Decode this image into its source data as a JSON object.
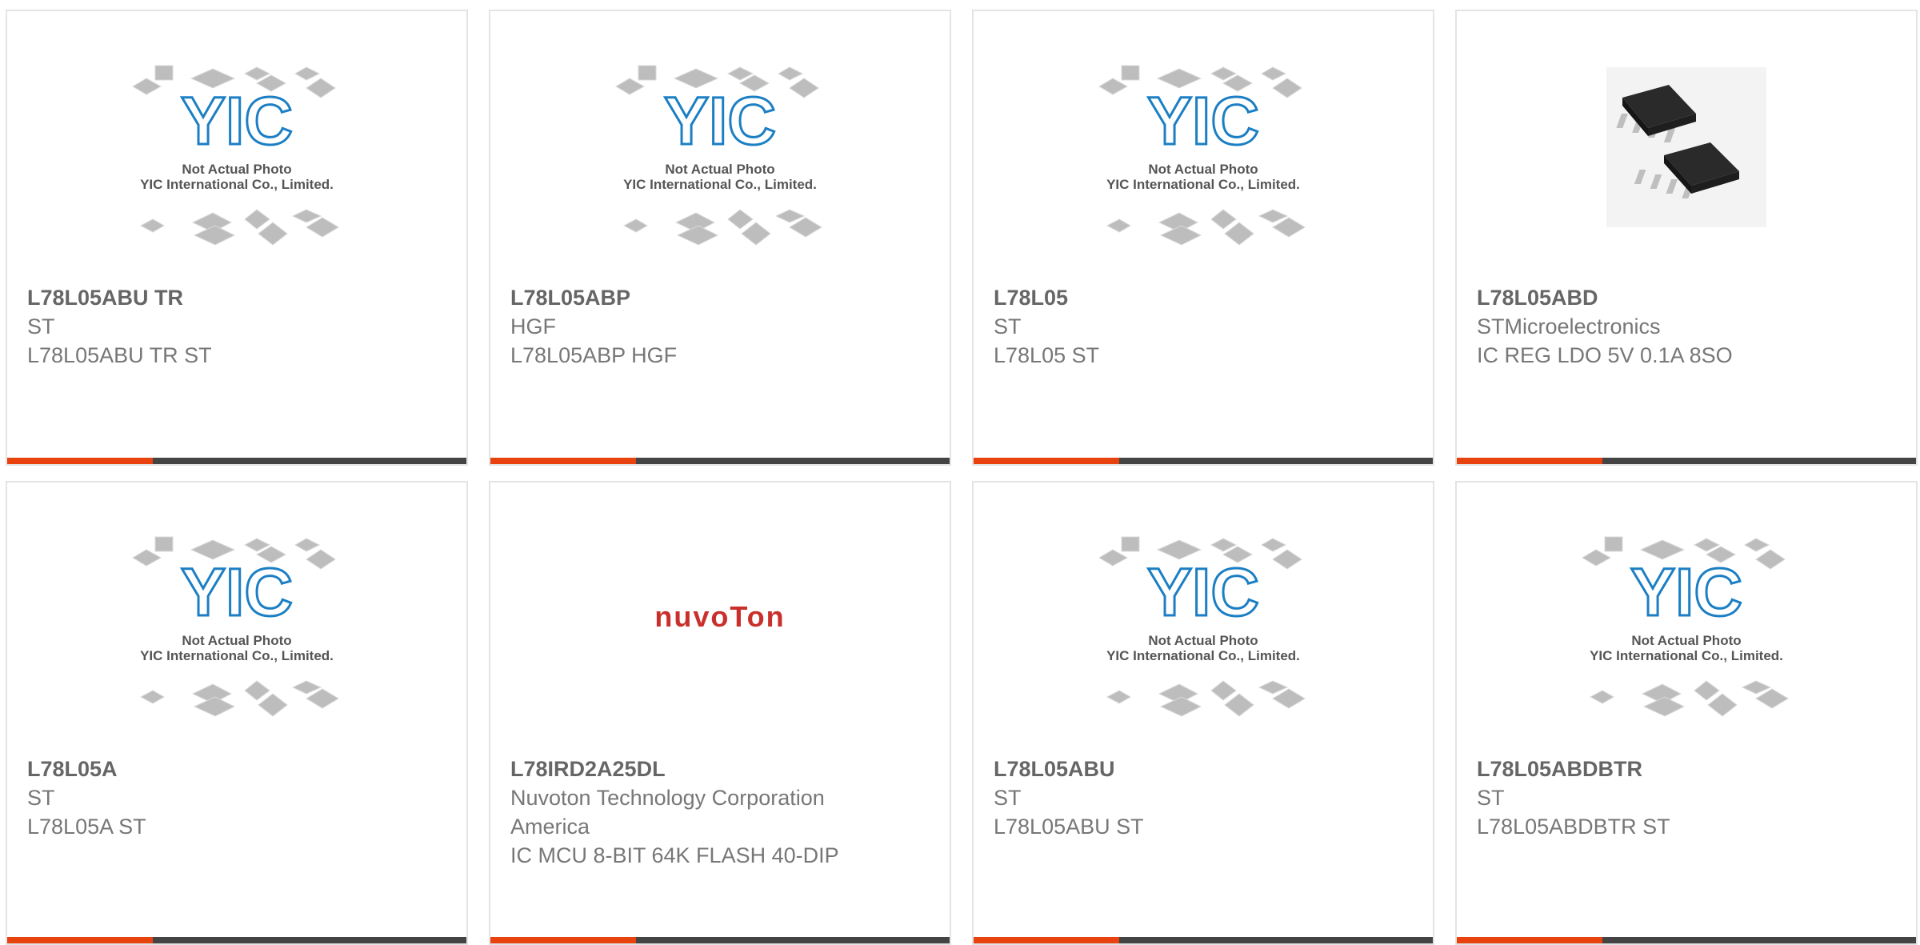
{
  "accent_color": "#e8430f",
  "bar_color": "#444444",
  "placeholder_image": {
    "line1": "Not Actual Photo",
    "line2": "YIC International Co., Limited.",
    "logo_text": "YIC",
    "logo_color": "#1c7fc4"
  },
  "nuvoton_logo": {
    "text": "nuvoTon",
    "color": "#c9302c"
  },
  "products": [
    {
      "part": "L78L05ABU TR",
      "manufacturer": "ST",
      "description": "L78L05ABU TR ST",
      "image": "placeholder"
    },
    {
      "part": "L78L05ABP",
      "manufacturer": "HGF",
      "description": "L78L05ABP HGF",
      "image": "placeholder"
    },
    {
      "part": "L78L05",
      "manufacturer": "ST",
      "description": "L78L05 ST",
      "image": "placeholder"
    },
    {
      "part": "L78L05ABD",
      "manufacturer": "STMicroelectronics",
      "description": "IC REG LDO 5V 0.1A 8SO",
      "image": "so8-chip-photo"
    },
    {
      "part": "L78L05A",
      "manufacturer": "ST",
      "description": "L78L05A ST",
      "image": "placeholder"
    },
    {
      "part": "L78IRD2A25DL",
      "manufacturer": "Nuvoton Technology Corporation America",
      "description": "IC MCU 8-BIT 64K FLASH 40-DIP",
      "image": "nuvoton-logo"
    },
    {
      "part": "L78L05ABU",
      "manufacturer": "ST",
      "description": "L78L05ABU ST",
      "image": "placeholder"
    },
    {
      "part": "L78L05ABDBTR",
      "manufacturer": "ST",
      "description": "L78L05ABDBTR ST",
      "image": "placeholder"
    }
  ]
}
